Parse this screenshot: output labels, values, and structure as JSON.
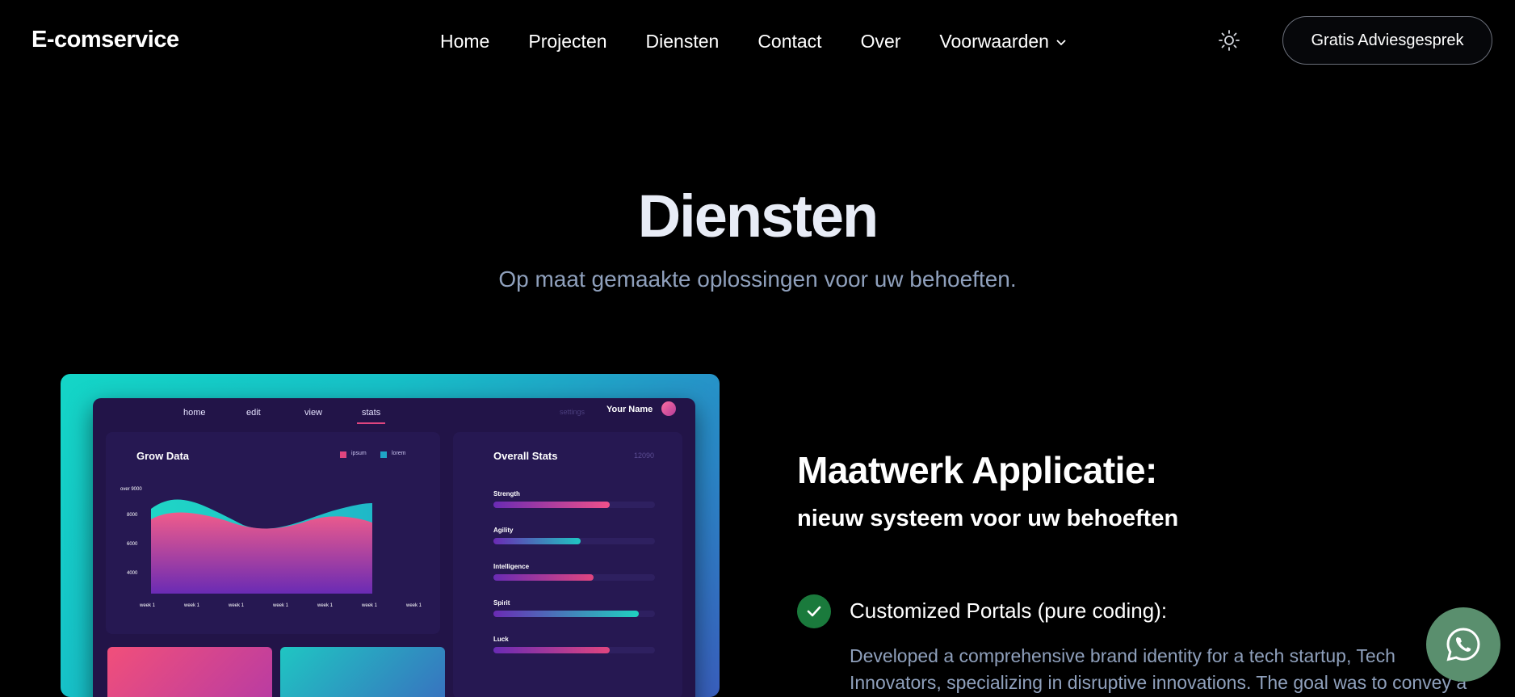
{
  "nav": {
    "brand": "E-comservice",
    "links": [
      "Home",
      "Projecten",
      "Diensten",
      "Contact",
      "Over",
      "Voorwaarden"
    ],
    "cta": "Gratis Adviesgesprek",
    "theme_icon": "sun-icon"
  },
  "hero": {
    "title": "Diensten",
    "subtitle": "Op maat gemaakte oplossingen voor uw behoeften."
  },
  "mockup": {
    "tabs": [
      "home",
      "edit",
      "view",
      "stats"
    ],
    "active_tab": "stats",
    "settings": "settings",
    "user": "Your Name",
    "grow_title": "Grow Data",
    "legend": [
      "ipsum",
      "lorem"
    ],
    "y_ticks": [
      "over 9000",
      "8000",
      "6000",
      "4000"
    ],
    "x_ticks": [
      "week 1",
      "week 1",
      "week 1",
      "week 1",
      "week 1",
      "week 1",
      "week 1"
    ],
    "stats_title": "Overall Stats",
    "stats_number": "12090",
    "stats": [
      {
        "label": "Strength",
        "value": 0.72,
        "color": "#f0508a"
      },
      {
        "label": "Agility",
        "value": 0.54,
        "color": "#1fc6c2"
      },
      {
        "label": "Intelligence",
        "value": 0.62,
        "color": "#e0457f"
      },
      {
        "label": "Spirit",
        "value": 0.9,
        "color": "#1fd2c0"
      },
      {
        "label": "Luck",
        "value": 0.72,
        "color": "#e0457f"
      }
    ]
  },
  "service": {
    "title": "Maatwerk Applicatie:",
    "subtitle": "nieuw systeem voor uw behoeften",
    "feature_title": "Customized Portals (pure coding):",
    "feature_desc": "Developed a comprehensive brand identity for a tech startup, Tech Innovators, specializing in disruptive innovations. The goal was to convey a"
  },
  "whatsapp_icon": "whatsapp-icon"
}
